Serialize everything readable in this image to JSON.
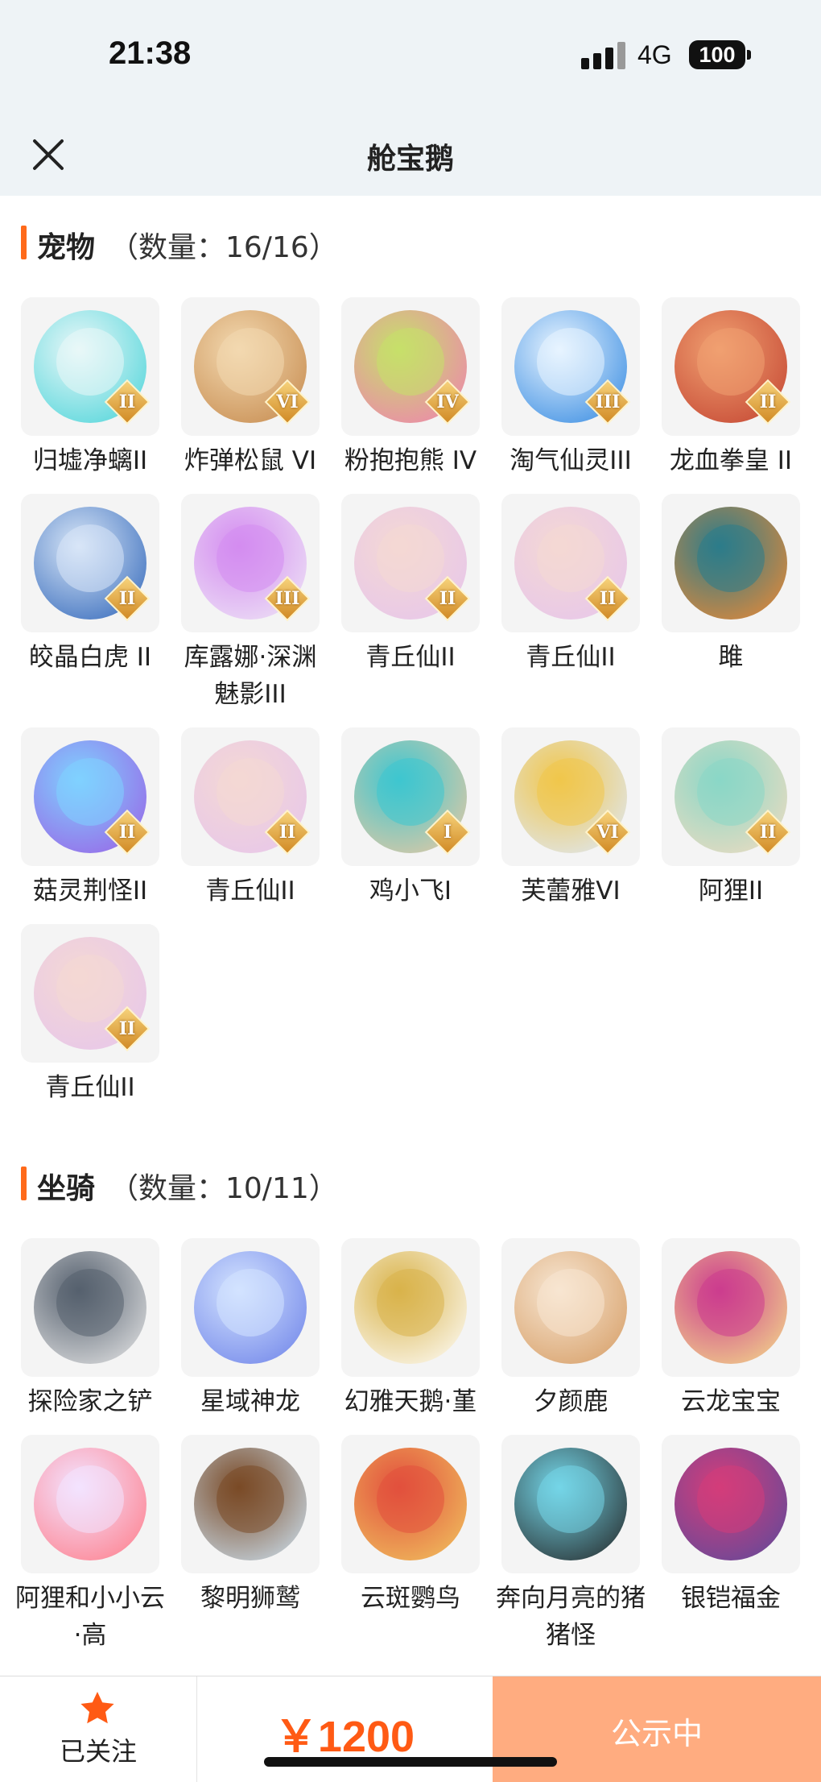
{
  "status_bar": {
    "time": "21:38",
    "network": "4G",
    "battery": "100"
  },
  "nav": {
    "title": "舱宝鹅",
    "close_icon": "close-icon"
  },
  "pets": {
    "title": "宠物",
    "count": "（数量：16/16）",
    "items": [
      {
        "name": "归墟净螭II",
        "level": "II",
        "icon": "cyan-dragon"
      },
      {
        "name": "炸弹松鼠 VI",
        "level": "VI",
        "icon": "squirrel"
      },
      {
        "name": "粉抱抱熊 IV",
        "level": "IV",
        "icon": "pink-bear"
      },
      {
        "name": "淘气仙灵III",
        "level": "III",
        "icon": "blue-dog"
      },
      {
        "name": "龙血拳皇 II",
        "level": "II",
        "icon": "red-demon"
      },
      {
        "name": "皎晶白虎 II",
        "level": "II",
        "icon": "white-tiger"
      },
      {
        "name": "库露娜·深渊魅影III",
        "level": "III",
        "icon": "white-hair-girl"
      },
      {
        "name": "青丘仙II",
        "level": "II",
        "icon": "fox-fairy"
      },
      {
        "name": "青丘仙II",
        "level": "II",
        "icon": "fox-fairy"
      },
      {
        "name": "雎",
        "level": "",
        "icon": "fire-bird"
      },
      {
        "name": "菇灵荆怪II",
        "level": "II",
        "icon": "purple-elf"
      },
      {
        "name": "青丘仙II",
        "level": "II",
        "icon": "fox-fairy"
      },
      {
        "name": "鸡小飞I",
        "level": "I",
        "icon": "blue-chick"
      },
      {
        "name": "芙蕾雅VI",
        "level": "VI",
        "icon": "valkyrie"
      },
      {
        "name": "阿狸II",
        "level": "II",
        "icon": "lion-dance"
      },
      {
        "name": "青丘仙II",
        "level": "II",
        "icon": "fox-fairy"
      }
    ]
  },
  "mounts": {
    "title": "坐骑",
    "count": "（数量：10/11）",
    "items": [
      {
        "name": "探险家之铲",
        "icon": "shovel"
      },
      {
        "name": "星域神龙",
        "icon": "star-dragon"
      },
      {
        "name": "幻雅天鹅·堇",
        "icon": "swan"
      },
      {
        "name": "夕颜鹿",
        "icon": "deer"
      },
      {
        "name": "云龙宝宝",
        "icon": "cloud-dragon"
      },
      {
        "name": "阿狸和小小云·高",
        "icon": "fox-cloud"
      },
      {
        "name": "黎明狮鹫",
        "icon": "griffin"
      },
      {
        "name": "云斑鹦鸟",
        "icon": "parrot"
      },
      {
        "name": "奔向月亮的猪猪怪",
        "icon": "pig"
      },
      {
        "name": "银铠福金",
        "icon": "armored-dragon"
      }
    ]
  },
  "bottom_bar": {
    "follow_label": "已关注",
    "price": "￥1200",
    "status_label": "公示中"
  },
  "colors": {
    "accent": "#ff6a1a",
    "price": "#ff5a14",
    "status_button": "#ffac80"
  }
}
